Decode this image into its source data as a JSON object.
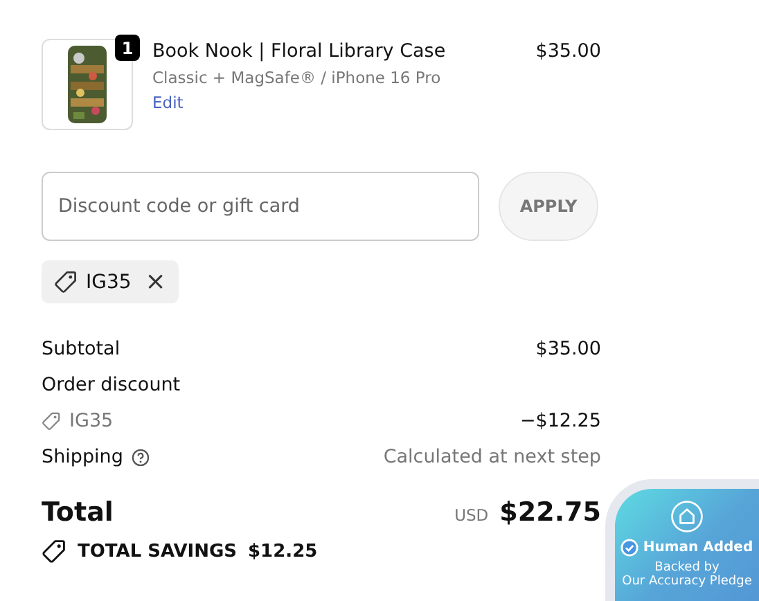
{
  "line_item": {
    "quantity": "1",
    "title": "Book Nook | Floral Library Case",
    "variant": "Classic + MagSafe® / iPhone 16 Pro",
    "edit_link": "Edit",
    "price": "$35.00"
  },
  "discount": {
    "placeholder": "Discount code or gift card",
    "apply_button": "APPLY",
    "applied_code": "IG35",
    "remove": "×"
  },
  "summary": {
    "subtotal_label": "Subtotal",
    "subtotal": "$35.00",
    "discount_label": "Order discount",
    "discount_code": "IG35",
    "discount_amount": "−$12.25",
    "shipping_label": "Shipping",
    "shipping": "Calculated at next step",
    "total_label": "Total",
    "currency": "USD",
    "total": "$22.75",
    "savings_label": "TOTAL SAVINGS",
    "savings": "$12.25"
  },
  "badge": {
    "title": "Human Added",
    "subtitle": "Backed by\nOur Accuracy Pledge"
  }
}
